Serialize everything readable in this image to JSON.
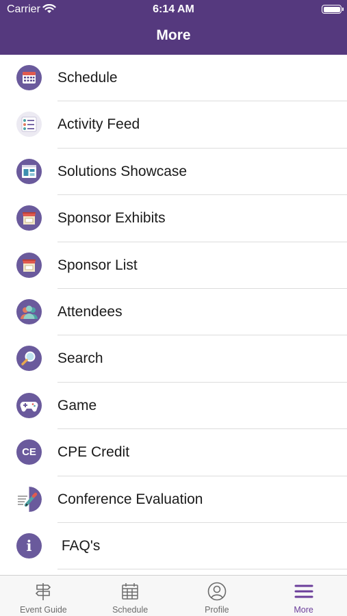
{
  "status_bar": {
    "carrier": "Carrier",
    "time": "6:14 AM"
  },
  "header": {
    "title": "More"
  },
  "menu_items": [
    {
      "label": "Schedule",
      "icon": "calendar-icon"
    },
    {
      "label": "Activity Feed",
      "icon": "activity-feed-icon"
    },
    {
      "label": "Solutions Showcase",
      "icon": "showcase-icon"
    },
    {
      "label": "Sponsor Exhibits",
      "icon": "booth-icon"
    },
    {
      "label": "Sponsor List",
      "icon": "booth-icon"
    },
    {
      "label": "Attendees",
      "icon": "attendees-icon"
    },
    {
      "label": "Search",
      "icon": "magnifier-icon"
    },
    {
      "label": "Game",
      "icon": "gamepad-icon"
    },
    {
      "label": "CPE Credit",
      "icon": "ce-badge-icon",
      "icon_text": "CE"
    },
    {
      "label": "Conference Evaluation",
      "icon": "evaluation-icon"
    },
    {
      "label": " FAQ's",
      "icon": "info-icon",
      "icon_text": "i"
    }
  ],
  "tab_bar": {
    "tabs": [
      {
        "label": "Event Guide",
        "icon": "signpost-icon",
        "active": false
      },
      {
        "label": "Schedule",
        "icon": "calendar-icon",
        "active": false
      },
      {
        "label": "Profile",
        "icon": "profile-icon",
        "active": false
      },
      {
        "label": "More",
        "icon": "menu-icon",
        "active": true
      }
    ]
  },
  "colors": {
    "header_bg": "#55397e",
    "icon_bg": "#6a5a9c",
    "active_tab": "#6b3e9a",
    "inactive_tab": "#6b6b6b"
  }
}
